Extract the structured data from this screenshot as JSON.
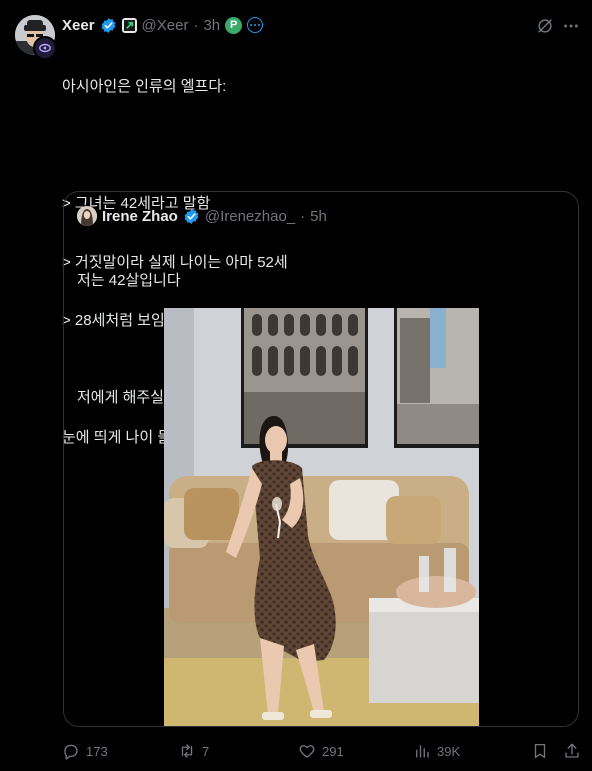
{
  "author": {
    "name": "Xeer",
    "handle": "@Xeer",
    "separator": "·",
    "time": "3h",
    "p_badge": "P"
  },
  "tweet": {
    "lines": [
      "아시아인은 인류의 엘프다:",
      "",
      "> 그녀는 42세라고 말함",
      "> 거짓말이라 실제 나이는 아마 52세",
      "> 28세처럼 보임",
      "",
      "눈에 띄게 나이 들어 보이지 않으려면 어떤 조언이 가장 좋을까요?"
    ]
  },
  "quoted": {
    "name": "Irene Zhao",
    "handle": "@Irenezhao_",
    "separator": "·",
    "time": "5h",
    "lines": [
      "저는 42살입니다",
      "",
      "저에게 해주실 수 있는 최고의 조언은 무엇인가요?"
    ]
  },
  "actions": {
    "replies": "173",
    "reposts": "7",
    "likes": "291",
    "views": "39K"
  },
  "icons": {
    "reply": "reply-icon",
    "repost": "repost-icon",
    "like": "heart-icon",
    "views": "views-icon",
    "bookmark": "bookmark-icon",
    "share": "share-icon",
    "grok": "grok-icon",
    "more": "more-icon",
    "verified": "verified-badge-icon"
  },
  "colors": {
    "background": "#000000",
    "text": "#e7e9ea",
    "muted": "#71767b",
    "accent": "#1d9bf0",
    "border": "#2f3336"
  }
}
